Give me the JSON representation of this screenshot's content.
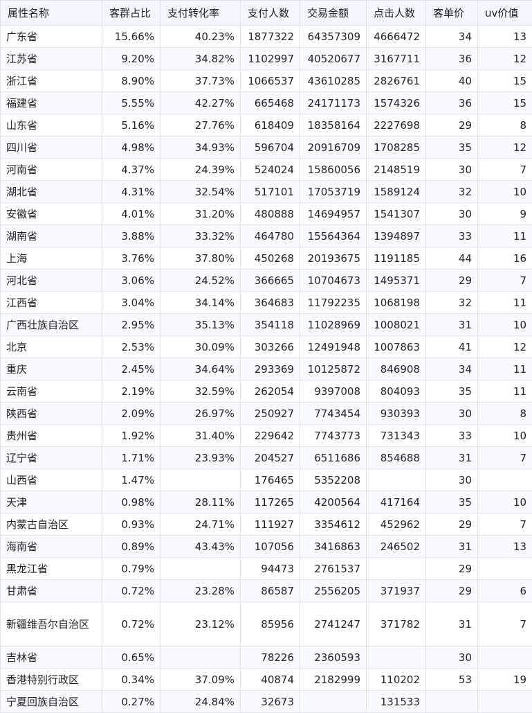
{
  "table": {
    "headers": [
      "属性名称",
      "客群占比",
      "支付转化率",
      "支付人数",
      "交易金额",
      "点击人数",
      "客单价",
      "uv价值"
    ],
    "rows": [
      [
        "广东省",
        "15.66%",
        "40.23%",
        "1877322",
        "64357309",
        "4666472",
        "34",
        "13"
      ],
      [
        "江苏省",
        "9.20%",
        "34.82%",
        "1102997",
        "40520677",
        "3167711",
        "36",
        "12"
      ],
      [
        "浙江省",
        "8.90%",
        "37.73%",
        "1066537",
        "43610285",
        "2826761",
        "40",
        "15"
      ],
      [
        "福建省",
        "5.55%",
        "42.27%",
        "665468",
        "24171173",
        "1574326",
        "36",
        "15"
      ],
      [
        "山东省",
        "5.16%",
        "27.76%",
        "618409",
        "18358164",
        "2227698",
        "29",
        "8"
      ],
      [
        "四川省",
        "4.98%",
        "34.93%",
        "596704",
        "20916709",
        "1708285",
        "35",
        "12"
      ],
      [
        "河南省",
        "4.37%",
        "24.39%",
        "524024",
        "15860056",
        "2148519",
        "30",
        "7"
      ],
      [
        "湖北省",
        "4.31%",
        "32.54%",
        "517101",
        "17053719",
        "1589124",
        "32",
        "10"
      ],
      [
        "安徽省",
        "4.01%",
        "31.20%",
        "480888",
        "14694957",
        "1541307",
        "30",
        "9"
      ],
      [
        "湖南省",
        "3.88%",
        "33.32%",
        "464780",
        "15564364",
        "1394897",
        "33",
        "11"
      ],
      [
        "上海",
        "3.76%",
        "37.80%",
        "450268",
        "20193675",
        "1191185",
        "44",
        "16"
      ],
      [
        "河北省",
        "3.06%",
        "24.52%",
        "366665",
        "10704673",
        "1495371",
        "29",
        "7"
      ],
      [
        "江西省",
        "3.04%",
        "34.14%",
        "364683",
        "11792235",
        "1068198",
        "32",
        "11"
      ],
      [
        "广西壮族自治区",
        "2.95%",
        "35.13%",
        "354118",
        "11028969",
        "1008021",
        "31",
        "10"
      ],
      [
        "北京",
        "2.53%",
        "30.09%",
        "303266",
        "12491948",
        "1007863",
        "41",
        "12"
      ],
      [
        "重庆",
        "2.45%",
        "34.64%",
        "293369",
        "10125872",
        "846908",
        "34",
        "11"
      ],
      [
        "云南省",
        "2.19%",
        "32.59%",
        "262054",
        "9397008",
        "804093",
        "35",
        "11"
      ],
      [
        "陕西省",
        "2.09%",
        "26.97%",
        "250927",
        "7743454",
        "930393",
        "30",
        "8"
      ],
      [
        "贵州省",
        "1.92%",
        "31.40%",
        "229642",
        "7743773",
        "731343",
        "33",
        "10"
      ],
      [
        "辽宁省",
        "1.71%",
        "23.93%",
        "204527",
        "6511686",
        "854688",
        "31",
        "7"
      ],
      [
        "山西省",
        "1.47%",
        "",
        "176465",
        "5352208",
        "",
        "30",
        ""
      ],
      [
        "天津",
        "0.98%",
        "28.11%",
        "117265",
        "4200564",
        "417164",
        "35",
        "10"
      ],
      [
        "内蒙古自治区",
        "0.93%",
        "24.71%",
        "111927",
        "3354612",
        "452962",
        "29",
        "7"
      ],
      [
        "海南省",
        "0.89%",
        "43.43%",
        "107056",
        "3416863",
        "246502",
        "31",
        "13"
      ],
      [
        "黑龙江省",
        "0.79%",
        "",
        "94473",
        "2761537",
        "",
        "29",
        ""
      ],
      [
        "甘肃省",
        "0.72%",
        "23.28%",
        "86587",
        "2556205",
        "371937",
        "29",
        "6"
      ],
      [
        "新疆维吾尔自治区",
        "0.72%",
        "23.12%",
        "85956",
        "2741247",
        "371782",
        "31",
        "7"
      ],
      [
        "吉林省",
        "0.65%",
        "",
        "78226",
        "2360593",
        "",
        "30",
        ""
      ],
      [
        "香港特别行政区",
        "0.34%",
        "37.09%",
        "40874",
        "2182999",
        "110202",
        "53",
        "19"
      ],
      [
        "宁夏回族自治区",
        "0.27%",
        "24.84%",
        "32673",
        "",
        "131533",
        "",
        ""
      ]
    ]
  }
}
